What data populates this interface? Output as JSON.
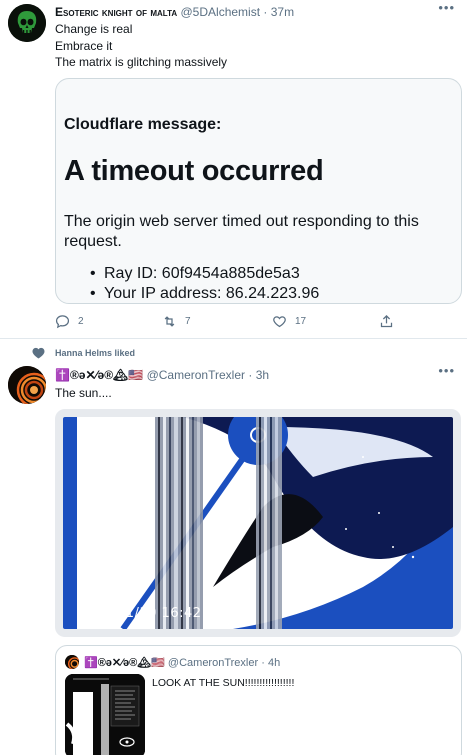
{
  "tweet1": {
    "name": "Esoteric knight of malta",
    "handle": "@5DAlchemist",
    "time": "37m",
    "lines": [
      "Change is real",
      "Embrace it",
      "The matrix is glitching massively"
    ],
    "card": {
      "label": "Cloudflare message:",
      "title": "A timeout occurred",
      "description": "The origin web server timed out responding to this request.",
      "items": [
        "Ray ID: 60f9454a885de5a3",
        "Your IP address: 86.24.223.96"
      ]
    },
    "actions": {
      "reply_count": "2",
      "retweet_count": "7",
      "like_count": "17"
    }
  },
  "social_context": "Hanna Helms liked",
  "tweet2": {
    "name": "✝️®ə✕⁄ə®🏔🇺🇸",
    "handle": "@CameronTrexler",
    "time": "3h",
    "text": "The sun....",
    "media_timestamp": "2021/01/10 16:42"
  },
  "quote": {
    "name": "✝️®ə✕⁄ə®🏔🇺🇸",
    "handle": "@CameronTrexler",
    "time": "4h",
    "text": "LOOK AT THE SUN!!!!!!!!!!!!!!!!!"
  },
  "colors": {
    "accent": "#1da1f2",
    "muted": "#5b7083",
    "card_bg": "#f7f9fa",
    "sun_blue": "#1b4fbf"
  },
  "icons": [
    "skull-avatar-icon",
    "more-icon",
    "reply-icon",
    "retweet-icon",
    "like-icon",
    "share-icon",
    "heart-icon"
  ]
}
